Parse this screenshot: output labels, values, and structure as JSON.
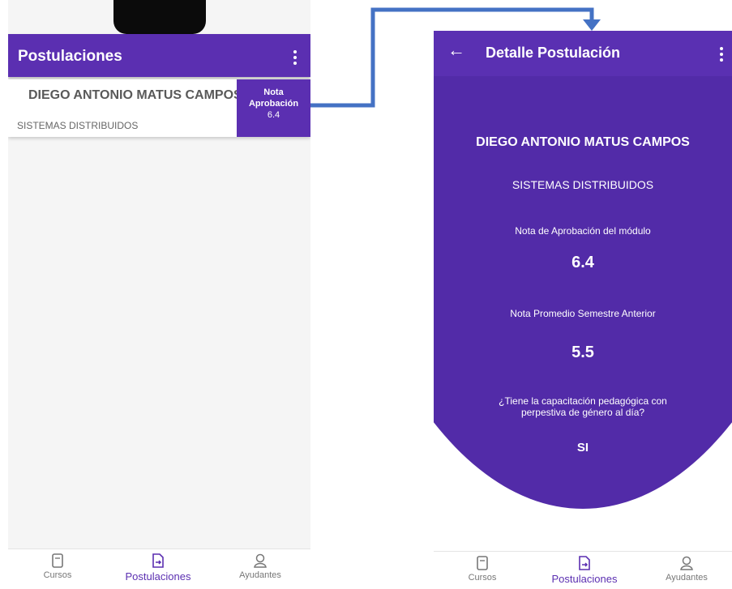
{
  "list_screen": {
    "title": "Postulaciones",
    "card": {
      "name": "DIEGO ANTONIO MATUS CAMPOS",
      "course": "SISTEMAS DISTRIBUIDOS",
      "badge_line1": "Nota",
      "badge_line2": "Aprobación",
      "badge_value": "6.4"
    }
  },
  "detail_screen": {
    "title": "Detalle Postulación",
    "name": "DIEGO ANTONIO MATUS CAMPOS",
    "course": "SISTEMAS DISTRIBUIDOS",
    "approval_label": "Nota de Aprobación del módulo",
    "approval_value": "6.4",
    "average_label": "Nota Promedio Semestre Anterior",
    "average_value": "5.5",
    "training_question_line1": "¿Tiene la capacitación pedagógica con",
    "training_question_line2": "perpestiva de género al día?",
    "training_answer": "SI"
  },
  "bottom_nav": {
    "items": [
      "Cursos",
      "Postulaciones",
      "Ayudantes"
    ],
    "active": "Postulaciones"
  },
  "colors": {
    "primary": "#5b2fb1",
    "connector": "#4472c4",
    "inactive_nav": "#777777"
  }
}
